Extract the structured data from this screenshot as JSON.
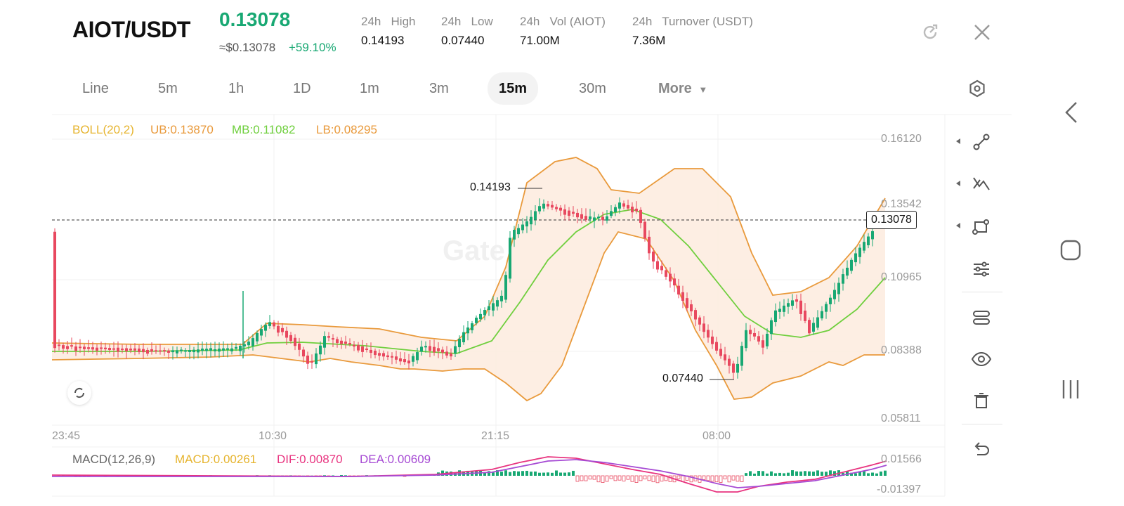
{
  "header": {
    "pair": "AIOT/USDT",
    "price": "0.13078",
    "usd_price": "≈$0.13078",
    "change": "+59.10%",
    "stats": [
      {
        "label": "24h   High",
        "value": "0.14193"
      },
      {
        "label": "24h   Low",
        "value": "0.07440"
      },
      {
        "label": "24h   Vol (AIOT)",
        "value": "71.00M"
      },
      {
        "label": "24h   Turnover (USDT)",
        "value": "7.36M"
      }
    ]
  },
  "timeframes": [
    "Line",
    "5m",
    "1h",
    "1D",
    "1m",
    "3m",
    "15m",
    "30m",
    "More"
  ],
  "active_timeframe": "15m",
  "boll": {
    "label": "BOLL(20,2)",
    "ub": "UB:0.13870",
    "mb": "MB:0.11082",
    "lb": "LB:0.08295"
  },
  "price_axis": [
    "0.16120",
    "0.13542",
    "0.10965",
    "0.08388",
    "0.05811"
  ],
  "time_axis": [
    "23:45",
    "10:30",
    "21:15",
    "08:00"
  ],
  "current_price_tag": "0.13078",
  "high_annotation": "0.14193",
  "low_annotation": "0.07440",
  "watermark": "Gate",
  "macd": {
    "label": "MACD(12,26,9)",
    "macd": "MACD:0.00261",
    "dif": "DIF:0.00870",
    "dea": "DEA:0.00609",
    "axis": [
      "0.01566",
      "-0.01397"
    ]
  },
  "colors": {
    "up": "#18a873",
    "down": "#e8485f",
    "boll_band": "#e99a3c",
    "mid_line": "#6fcf3d",
    "boll_label": "#e6b42e",
    "macd_label": "#e6b42e",
    "dif": "#e8337f",
    "dea": "#a64ad4"
  },
  "tools": [
    "line-tool-icon",
    "trend-tool-icon",
    "shape-tool-icon",
    "indicator-settings-icon",
    "layers-icon",
    "visibility-icon",
    "delete-icon",
    "undo-icon"
  ]
}
